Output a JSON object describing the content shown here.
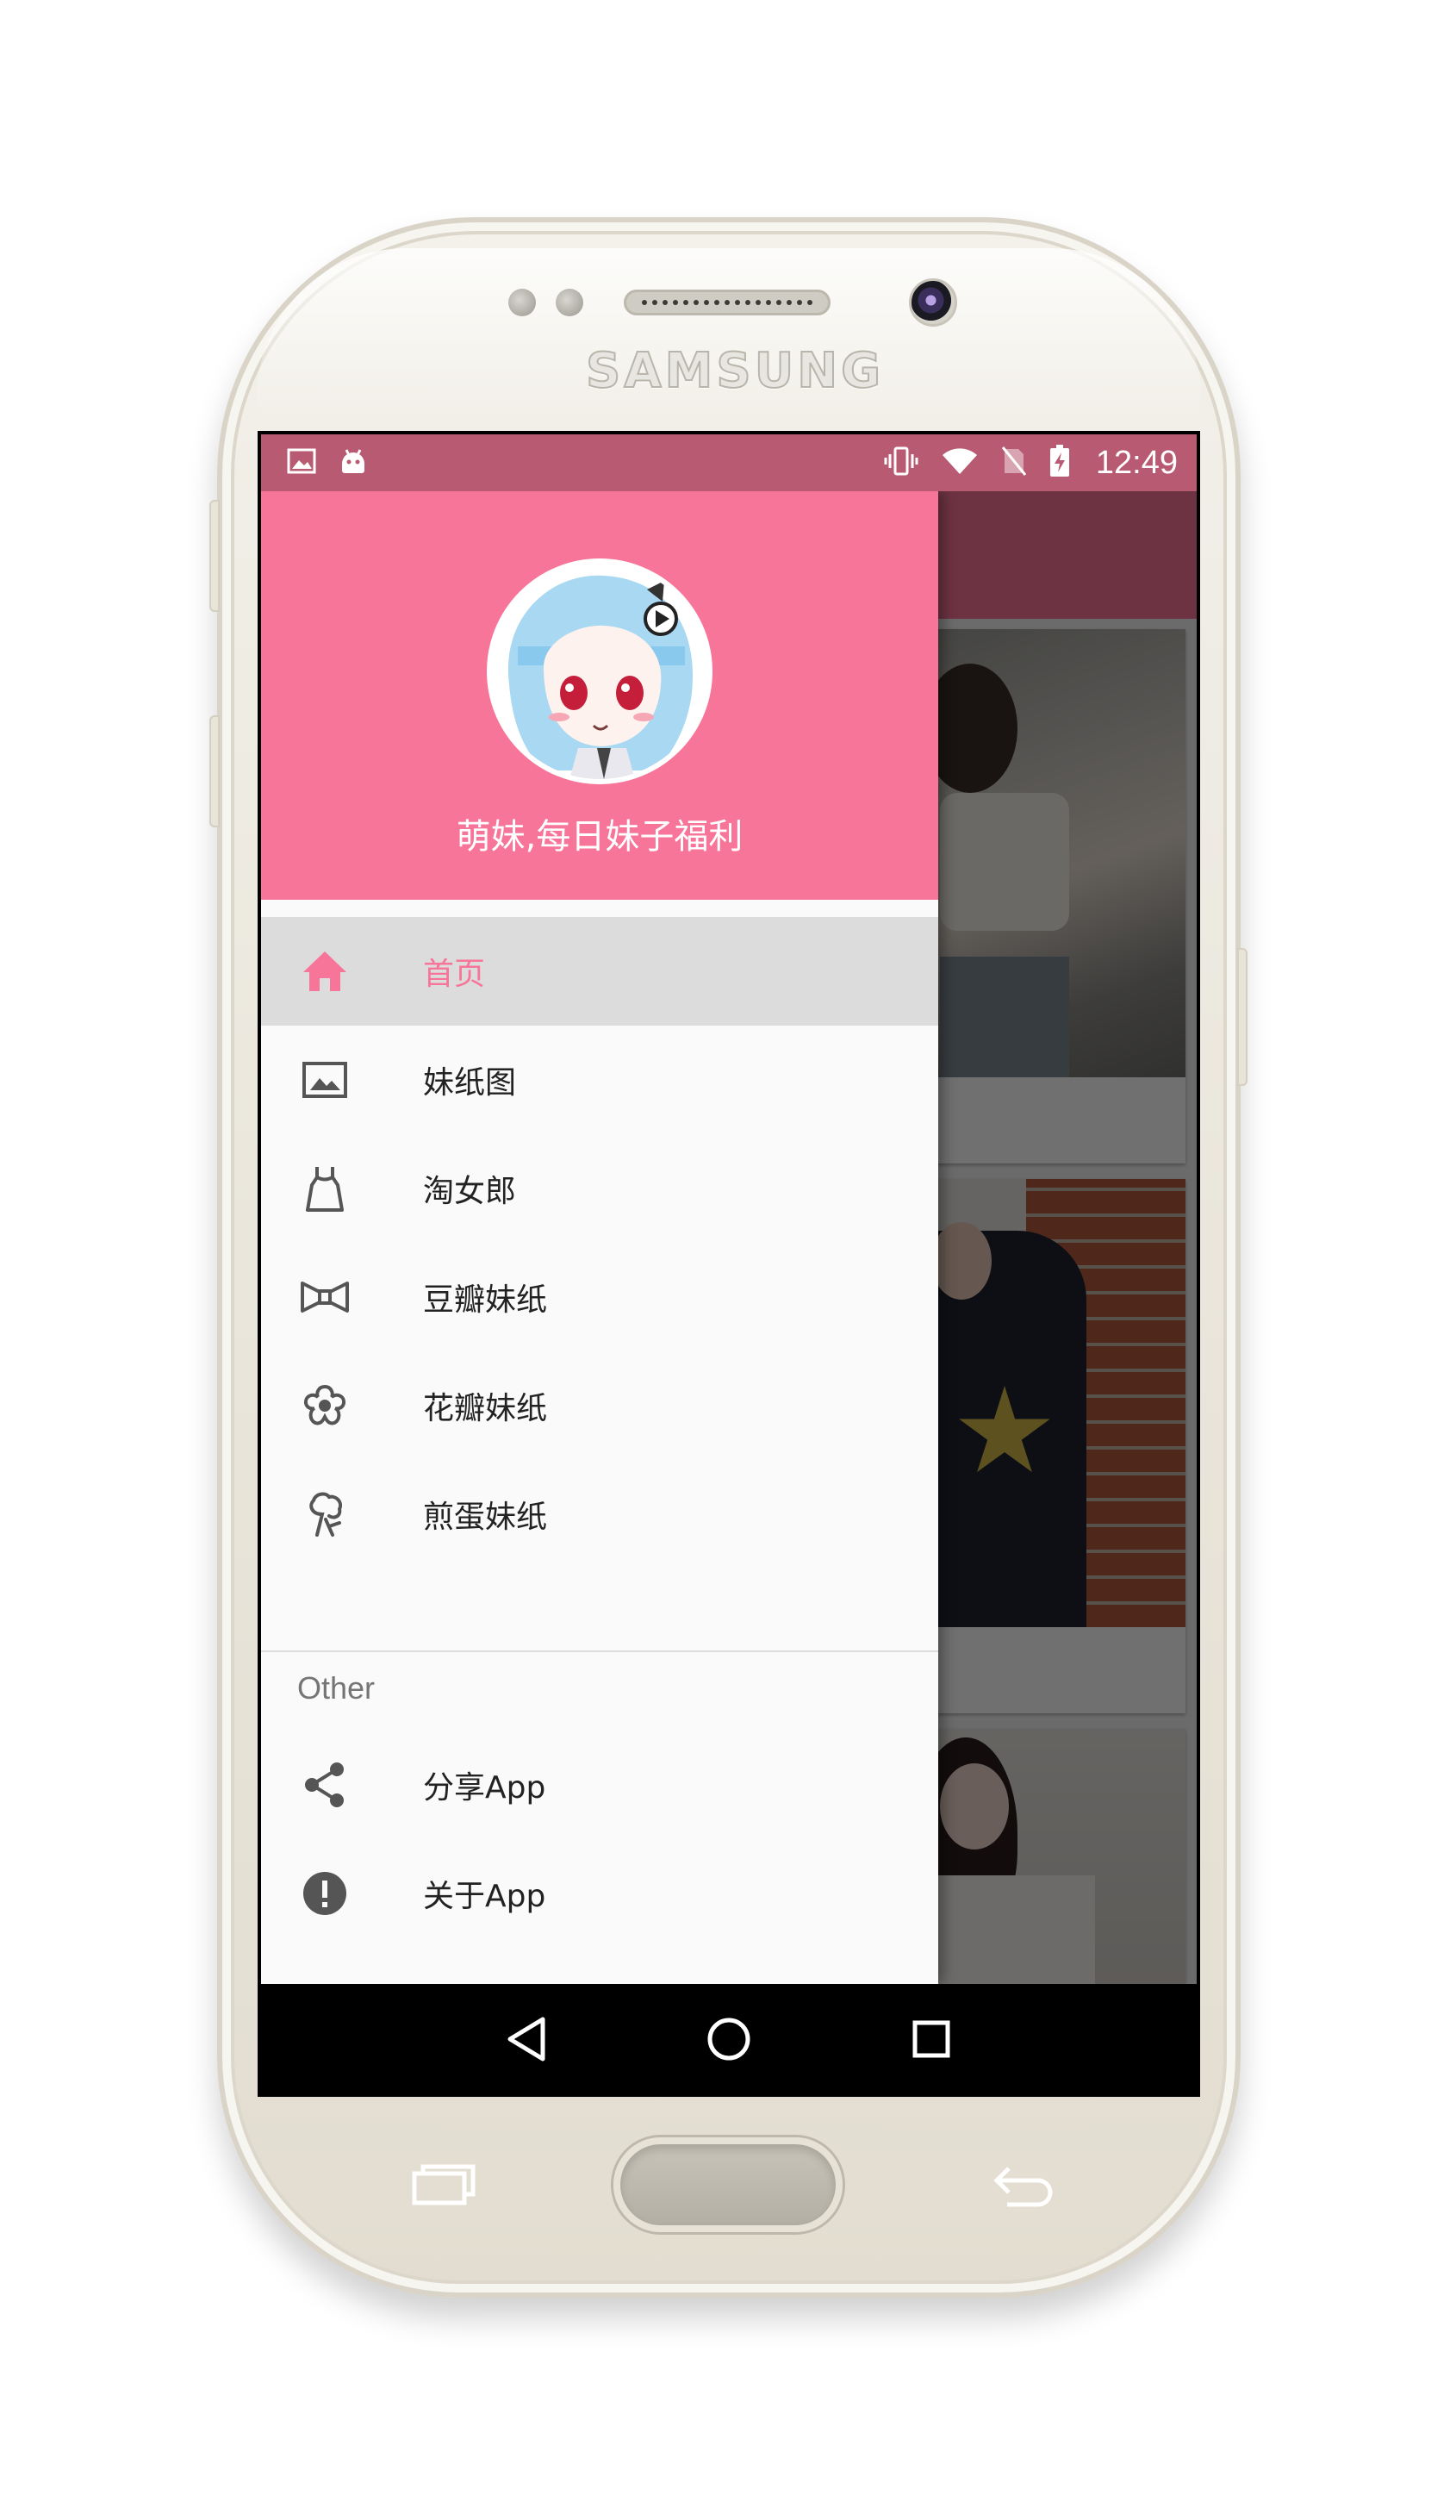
{
  "device": {
    "brand": "SAMSUNG"
  },
  "status_bar": {
    "time": "12:49",
    "left_icons": [
      "image-notification-icon",
      "android-notification-icon"
    ],
    "right_icons": [
      "vibrate-icon",
      "wifi-icon",
      "no-sim-icon",
      "battery-charging-icon"
    ]
  },
  "drawer": {
    "header_title": "萌妹,每日妹子福利",
    "items": [
      {
        "label": "首页",
        "icon": "home-icon",
        "active": true
      },
      {
        "label": "妹纸图",
        "icon": "image-icon",
        "active": false
      },
      {
        "label": "淘女郎",
        "icon": "dress-icon",
        "active": false
      },
      {
        "label": "豆瓣妹纸",
        "icon": "bowtie-icon",
        "active": false
      },
      {
        "label": "花瓣妹纸",
        "icon": "flower-icon",
        "active": false
      },
      {
        "label": "煎蛋妹纸",
        "icon": "tree-icon",
        "active": false
      }
    ],
    "section_title": "Other",
    "other_items": [
      {
        "label": "分享App",
        "icon": "share-icon"
      },
      {
        "label": "关于App",
        "icon": "info-icon"
      }
    ]
  },
  "colors": {
    "accent": "#f8759a",
    "status_bar": "#b85a71",
    "active_item_bg": "#dcdcdc"
  },
  "nav_bar": {
    "buttons": [
      "back-icon",
      "home-circle-icon",
      "recents-icon"
    ]
  }
}
